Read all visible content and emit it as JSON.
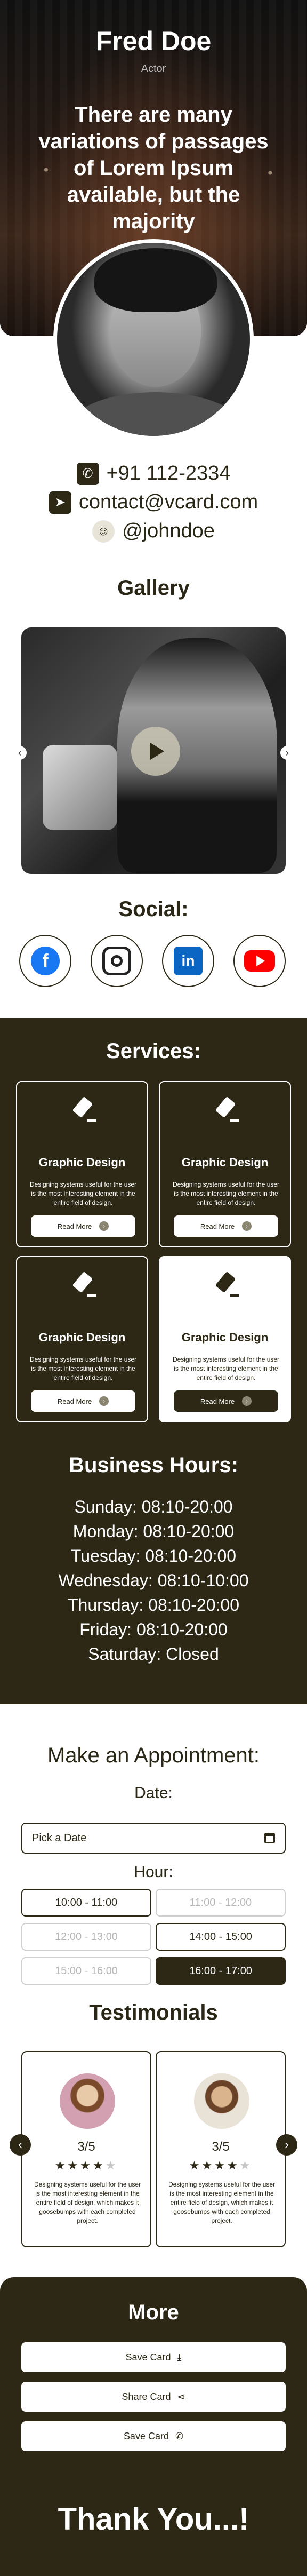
{
  "profile": {
    "name": "Fred Doe",
    "role": "Actor",
    "tagline": "There are many variations of passages of Lorem Ipsum available, but the majority"
  },
  "contacts": {
    "phone": "+91 112-2334",
    "email": "contact@vcard.com",
    "handle": "@johndoe"
  },
  "gallery": {
    "title": "Gallery"
  },
  "social": {
    "title": "Social:",
    "items": [
      {
        "name": "facebook-icon",
        "color": "#1877f2"
      },
      {
        "name": "instagram-icon",
        "color": "#222222"
      },
      {
        "name": "linkedin-icon",
        "color": "#0a66c2"
      },
      {
        "name": "youtube-icon",
        "color": "#ff0000"
      }
    ]
  },
  "services": {
    "title": "Services:",
    "items": [
      {
        "title": "Graphic Design",
        "desc": "Designing systems useful for the user is the most interesting element in the entire field of design.",
        "button": "Read More"
      },
      {
        "title": "Graphic Design",
        "desc": "Designing systems useful for the user is the most interesting element in the entire field of design.",
        "button": "Read More"
      },
      {
        "title": "Graphic Design",
        "desc": "Designing systems useful for the user is the most interesting element in the entire field of design.",
        "button": "Read More"
      },
      {
        "title": "Graphic Design",
        "desc": "Designing systems useful for the user is the most interesting element in the entire field of design.",
        "button": "Read More"
      }
    ]
  },
  "hours": {
    "title": "Business Hours:",
    "days": [
      "Sunday: 08:10-20:00",
      "Monday: 08:10-20:00",
      "Tuesday: 08:10-20:00",
      "Wednesday: 08:10-10:00",
      "Thursday: 08:10-20:00",
      "Friday: 08:10-20:00",
      "Saturday: Closed"
    ]
  },
  "appointment": {
    "title": "Make an Appointment:",
    "date_label": "Date:",
    "date_placeholder": "Pick a Date",
    "hour_label": "Hour:",
    "slots": [
      {
        "label": "10:00 - 11:00",
        "state": "available"
      },
      {
        "label": "11:00 - 12:00",
        "state": "disabled"
      },
      {
        "label": "12:00 - 13:00",
        "state": "disabled"
      },
      {
        "label": "14:00 - 15:00",
        "state": "available"
      },
      {
        "label": "15:00 - 16:00",
        "state": "disabled"
      },
      {
        "label": "16:00 - 17:00",
        "state": "selected"
      }
    ]
  },
  "testimonials": {
    "title": "Testimonials",
    "items": [
      {
        "score": "3/5",
        "stars": 4,
        "text": "Designing systems useful for the user is the most interesting element in the entire field of design, which makes it goosebumps with each completed project."
      },
      {
        "score": "3/5",
        "stars": 4,
        "text": "Designing systems useful for the user is the most interesting element in the entire field of design, which makes it goosebumps with each completed project."
      }
    ]
  },
  "more": {
    "title": "More",
    "buttons": [
      "Save Card",
      "Share Card",
      "Save Card"
    ],
    "thanks": "Thank You...!"
  },
  "colors": {
    "accent": "#2c2815",
    "light": "#ffffff"
  }
}
